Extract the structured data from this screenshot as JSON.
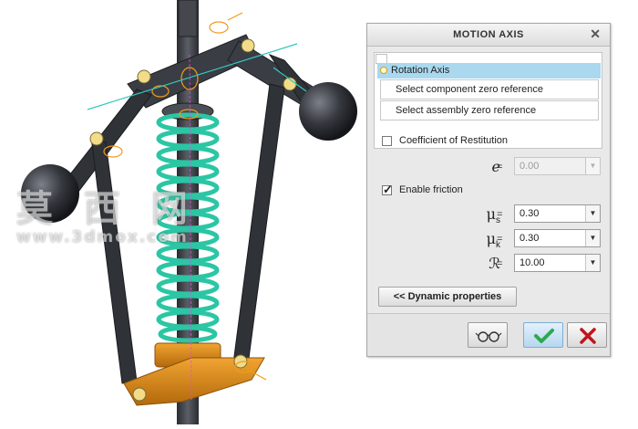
{
  "watermark": {
    "chinese": "莫 西 网",
    "url": "www.3dmox.com"
  },
  "dialog": {
    "title": "MOTION AXIS",
    "close_glyph": "✕",
    "reference": {
      "axis_label": "Rotation Axis",
      "component_zero": "Select component zero reference",
      "assembly_zero": "Select assembly zero reference"
    },
    "restitution": {
      "label": "Coefficient of Restitution",
      "checked": false,
      "symbol": "e",
      "equals": "=",
      "value": "0.00",
      "enabled": false
    },
    "friction": {
      "label": "Enable friction",
      "checked": true,
      "params": [
        {
          "symbol": "μ",
          "subscript": "s",
          "equals": "=",
          "value": "0.30"
        },
        {
          "symbol": "μ",
          "subscript": "k",
          "equals": "=",
          "value": "0.30"
        },
        {
          "symbol": "ℛ",
          "subscript": "",
          "equals": "=",
          "value": "10.00"
        }
      ]
    },
    "dynamic_button": "<< Dynamic properties",
    "footer": {
      "preview_icon": "glasses-icon",
      "ok_icon": "checkmark-icon",
      "cancel_icon": "x-icon"
    }
  },
  "colors": {
    "selected_row": "#a9d8ef",
    "ok_check": "#2fa84f",
    "cancel_x": "#c0141b",
    "spring": "#2bc6a4",
    "arm": "#34373c",
    "base": "#d98a17"
  }
}
